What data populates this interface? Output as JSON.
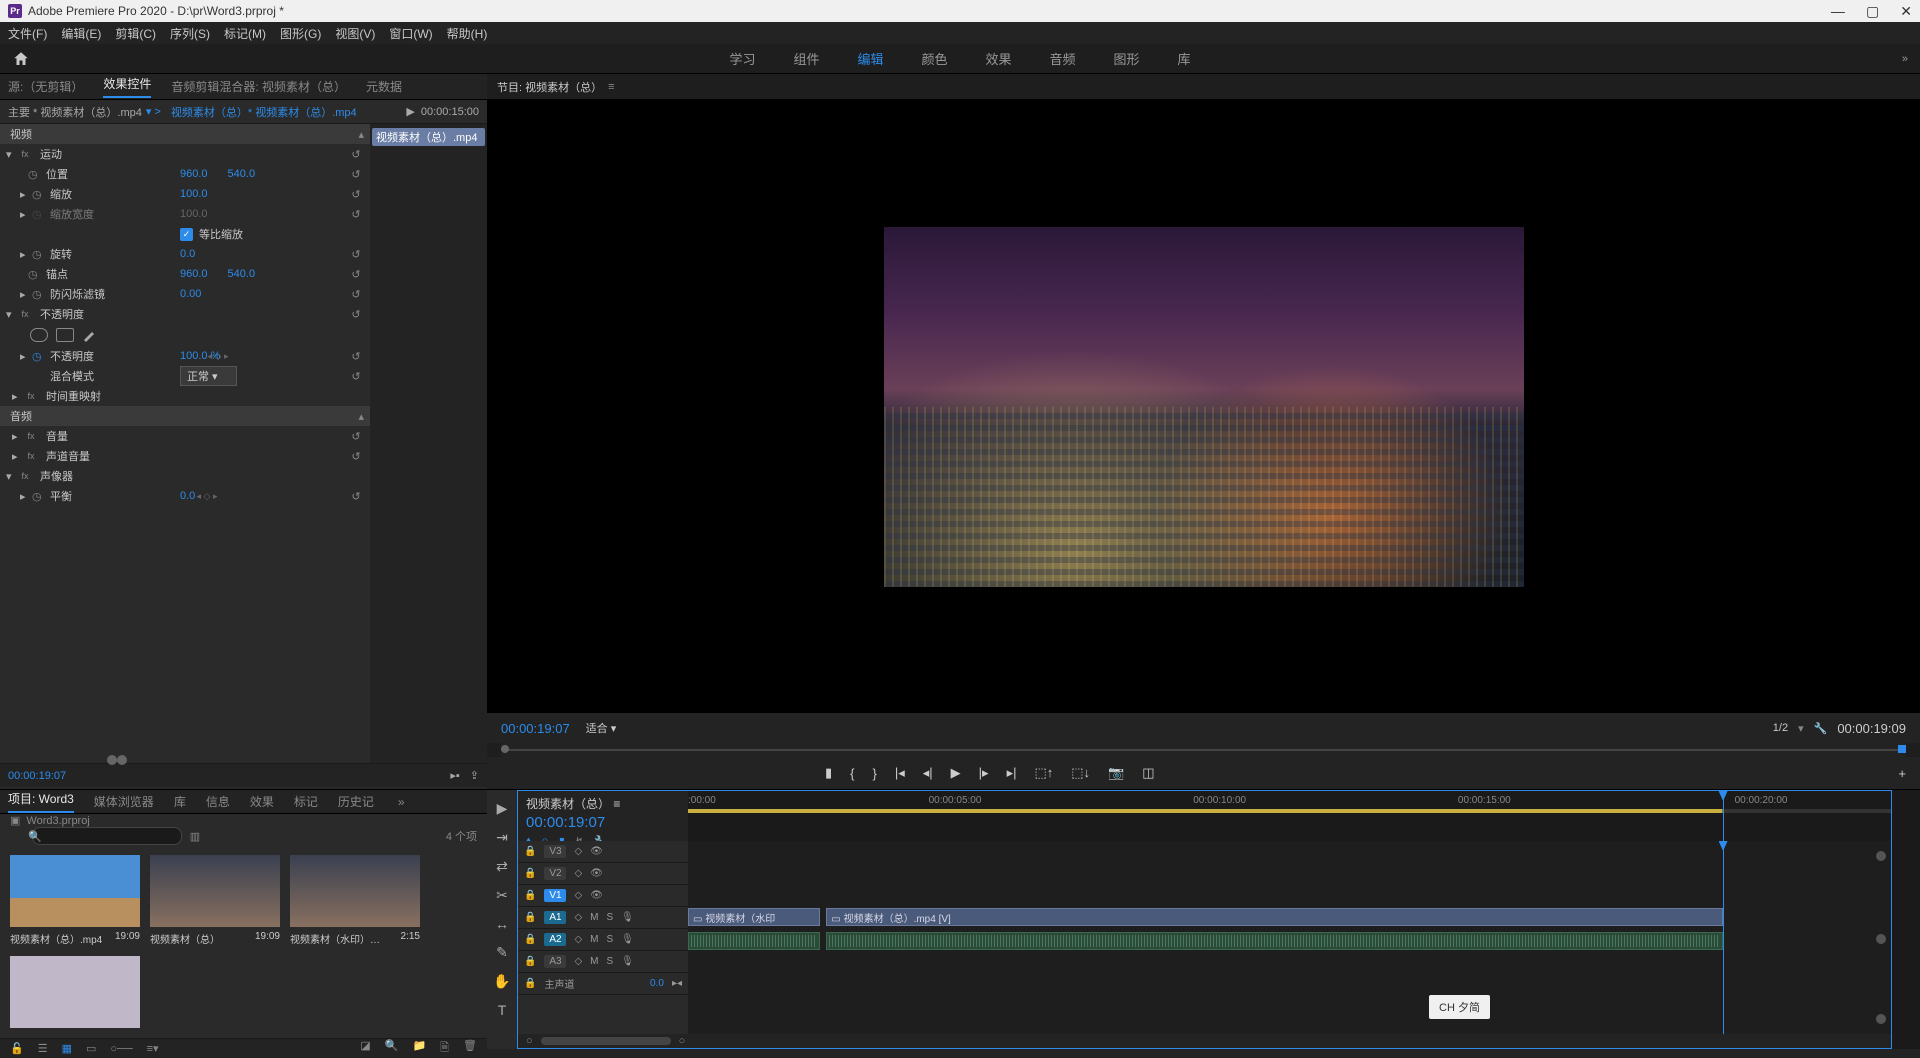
{
  "app": {
    "title": "Adobe Premiere Pro 2020 - D:\\pr\\Word3.prproj *",
    "icon_label": "Pr"
  },
  "menu": [
    "文件(F)",
    "编辑(E)",
    "剪辑(C)",
    "序列(S)",
    "标记(M)",
    "图形(G)",
    "视图(V)",
    "窗口(W)",
    "帮助(H)"
  ],
  "topnav": {
    "tabs": [
      "学习",
      "组件",
      "编辑",
      "颜色",
      "效果",
      "音频",
      "图形",
      "库"
    ],
    "active_index": 2
  },
  "source_panel": {
    "tabs": [
      "源:（无剪辑）",
      "效果控件",
      "音频剪辑混合器: 视频素材（总）",
      "元数据"
    ],
    "active_index": 1,
    "breadcrumb_master": "主要 * 视频素材（总）.mp4",
    "breadcrumb_clip": "视频素材（总）* 视频素材（总）.mp4",
    "header_time": "00:00:15:00",
    "clip_label": "视频素材（总）.mp4",
    "sections": {
      "video": "视频",
      "motion": "运动",
      "position": "位置",
      "position_x": "960.0",
      "position_y": "540.0",
      "scale": "缩放",
      "scale_val": "100.0",
      "scale_width": "缩放宽度",
      "scale_width_val": "100.0",
      "uniform": "等比缩放",
      "rotation": "旋转",
      "rotation_val": "0.0",
      "anchor": "锚点",
      "anchor_x": "960.0",
      "anchor_y": "540.0",
      "antiflicker": "防闪烁滤镜",
      "antiflicker_val": "0.00",
      "opacity_sec": "不透明度",
      "opacity": "不透明度",
      "opacity_val": "100.0 %",
      "blend": "混合模式",
      "blend_val": "正常",
      "time_remap": "时间重映射",
      "audio": "音频",
      "volume": "音量",
      "channel_vol": "声道音量",
      "panner": "声像器",
      "balance": "平衡",
      "balance_val": "0.0"
    },
    "footer_tc": "00:00:19:07"
  },
  "project_panel": {
    "tabs": [
      "项目: Word3",
      "媒体浏览器",
      "库",
      "信息",
      "效果",
      "标记",
      "历史记"
    ],
    "active_index": 0,
    "project_file": "Word3.prproj",
    "search_placeholder": "",
    "item_count": "4 个项",
    "items": [
      {
        "name": "视频素材（总）.mp4",
        "dur": "19:09",
        "thumb": "sky"
      },
      {
        "name": "视频素材（总）",
        "dur": "19:09",
        "thumb": "city"
      },
      {
        "name": "视频素材（水印）…",
        "dur": "2:15",
        "thumb": "city"
      },
      {
        "name": "",
        "dur": "",
        "thumb": "blank"
      }
    ]
  },
  "program_panel": {
    "tab": "节目: 视频素材（总）",
    "tc_left": "00:00:19:07",
    "zoom": "适合",
    "page": "1/2",
    "tc_right": "00:00:19:09"
  },
  "timeline_panel": {
    "sequence_name": "视频素材（总）",
    "sequence_tc": "00:00:19:07",
    "ruler": [
      ":00:00",
      "00:00:05:00",
      "00:00:10:00",
      "00:00:15:00",
      "00:00:20:00"
    ],
    "tracks": {
      "v3": "V3",
      "v2": "V2",
      "v1": "V1",
      "a1": "A1",
      "a2": "A2",
      "a3": "A3",
      "master": "主声道",
      "master_val": "0.0",
      "m": "M",
      "s": "S"
    },
    "clips": {
      "v1a": "视频素材（水印",
      "v1b": "视频素材（总）.mp4 [V]"
    },
    "ime": "CH 夕简"
  }
}
